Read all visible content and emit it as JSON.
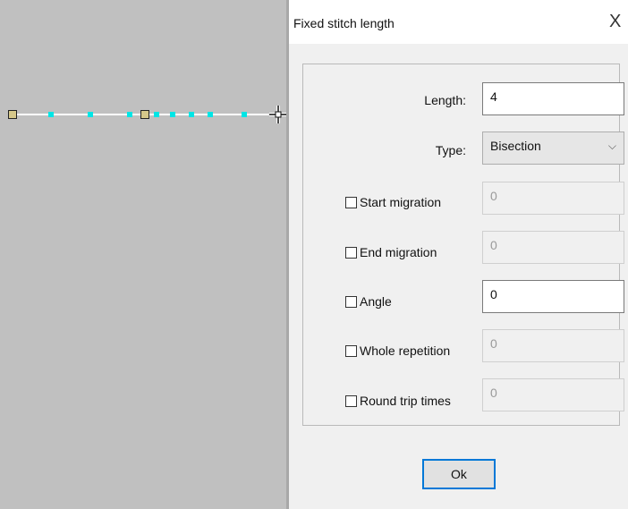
{
  "dialog": {
    "title": "Fixed stitch length",
    "close_glyph": "X",
    "fields": {
      "length": {
        "label": "Length:",
        "value": "4"
      },
      "type": {
        "label": "Type:",
        "value": "Bisection",
        "chevron": "⌵"
      },
      "start_migration": {
        "label": "Start migration",
        "value": "0",
        "checked": false
      },
      "end_migration": {
        "label": "End migration",
        "value": "0",
        "checked": false
      },
      "angle": {
        "label": "Angle",
        "value": "0",
        "checked": false
      },
      "whole_repetition": {
        "label": "Whole repetition",
        "value": "0",
        "checked": false
      },
      "round_trip_times": {
        "label": "Round trip times",
        "value": "0",
        "checked": false
      }
    },
    "ok_label": "Ok"
  },
  "canvas": {
    "cursor_icon": "move-crosshair-icon",
    "stitch_color": "#00e5e5",
    "anchor_color": "#d6c88a"
  }
}
